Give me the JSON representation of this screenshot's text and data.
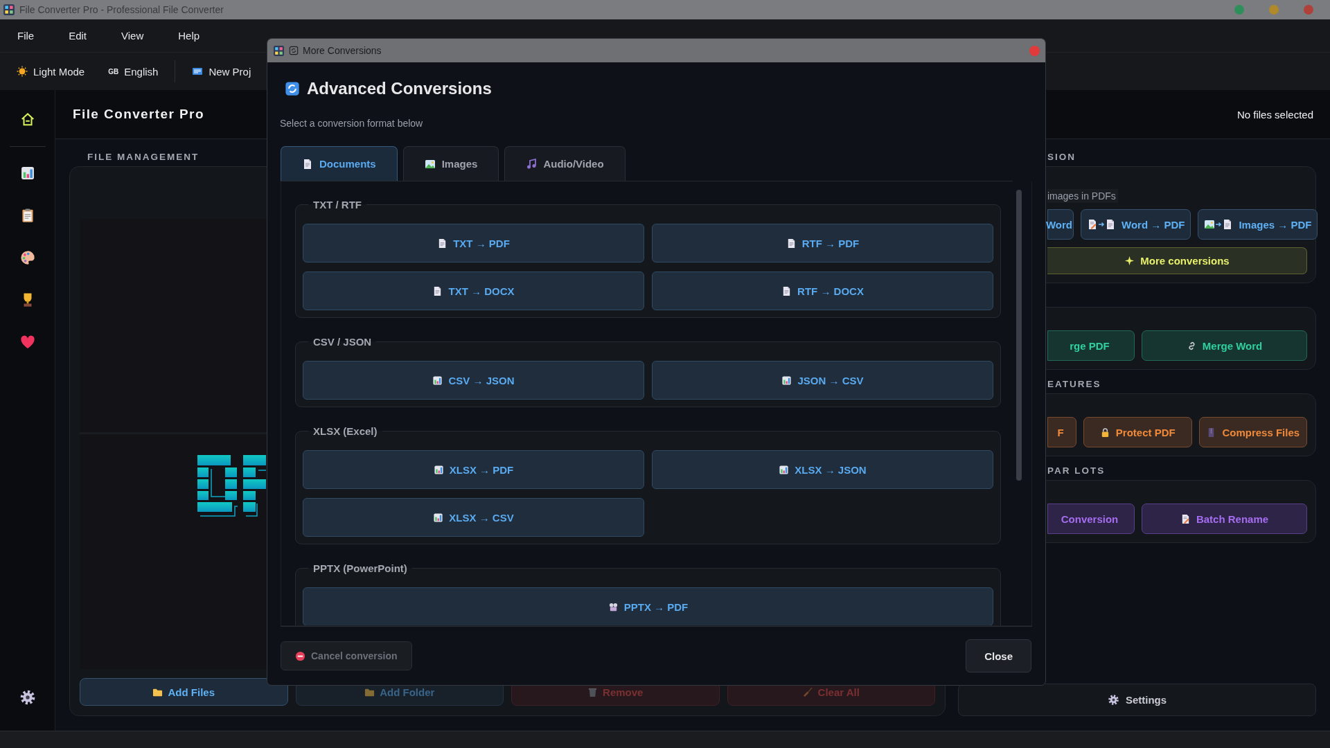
{
  "os_window": {
    "title": "File Converter Pro - Professional File Converter"
  },
  "menu": [
    "File",
    "Edit",
    "View",
    "Help"
  ],
  "toolbar": [
    {
      "label": "Light Mode"
    },
    {
      "flag": "GB",
      "label": "English"
    },
    {
      "label": "New Proj"
    }
  ],
  "header": {
    "title": "File Converter Pro",
    "status": "No files selected"
  },
  "file_management": {
    "title": "FILE MANAGEMENT",
    "buttons": [
      {
        "label": "Add Files",
        "disabled": false
      },
      {
        "label": "Add Folder",
        "disabled": true
      },
      {
        "label": "Remove",
        "disabled": true
      },
      {
        "label": "Clear All",
        "disabled": true
      }
    ]
  },
  "right_panel": {
    "sections": [
      {
        "title": "SION",
        "note": "images in PDFs",
        "buttons": [
          {
            "kind": "cut",
            "label": "Word"
          },
          {
            "kind": "full",
            "label": "Word → PDF"
          },
          {
            "kind": "full",
            "label": "Images → PDF"
          }
        ],
        "wide_button": "More conversions"
      },
      {
        "buttons": [
          {
            "kind": "cut",
            "label": "rge PDF"
          },
          {
            "kind": "full",
            "label": "Merge Word"
          }
        ]
      },
      {
        "title": "EATURES",
        "buttons": [
          {
            "kind": "cut",
            "label": "F"
          },
          {
            "kind": "full",
            "label": "Protect PDF"
          },
          {
            "kind": "full",
            "label": "Compress Files"
          }
        ]
      },
      {
        "title": "PAR LOTS",
        "buttons": [
          {
            "kind": "cut",
            "label": "Conversion"
          },
          {
            "kind": "full",
            "label": "Batch Rename"
          }
        ]
      }
    ],
    "settings": "Settings"
  },
  "dialog": {
    "title": "More Conversions",
    "heading": "Advanced Conversions",
    "subtitle": "Select a conversion format below",
    "tabs": [
      {
        "label": "Documents",
        "selected": true
      },
      {
        "label": "Images",
        "selected": false
      },
      {
        "label": "Audio/Video",
        "selected": false
      }
    ],
    "groups": [
      {
        "title": "TXT / RTF",
        "kind": "grid",
        "buttons": [
          "TXT → PDF",
          "RTF → PDF",
          "TXT → DOCX",
          "RTF → DOCX"
        ]
      },
      {
        "title": "CSV / JSON",
        "kind": "grid",
        "buttons": [
          "CSV → JSON",
          "JSON → CSV"
        ]
      },
      {
        "title": "XLSX (Excel)",
        "kind": "grid",
        "buttons": [
          "XLSX → PDF",
          "XLSX → JSON",
          "XLSX → CSV"
        ]
      },
      {
        "title": "PPTX (PowerPoint)",
        "kind": "wide",
        "buttons": [
          "PPTX → PDF"
        ]
      }
    ],
    "cancel": {
      "label": "Cancel conversion",
      "disabled": true
    },
    "close": "Close"
  }
}
